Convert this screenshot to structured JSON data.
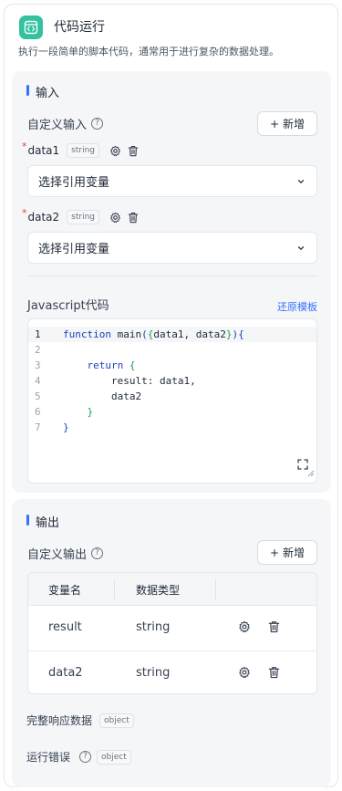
{
  "header": {
    "title": "代码运行",
    "description": "执行一段简单的脚本代码，通常用于进行复杂的数据处理。"
  },
  "input_section": {
    "title": "输入",
    "custom_input_label": "自定义输入",
    "add_label": "新增",
    "variables": [
      {
        "name": "data1",
        "type": "string",
        "placeholder": "选择引用变量"
      },
      {
        "name": "data2",
        "type": "string",
        "placeholder": "选择引用变量"
      }
    ],
    "code_label": "Javascript代码",
    "restore_label": "还原模板",
    "line_numbers": [
      "1",
      "2",
      "3",
      "4",
      "5",
      "6",
      "7"
    ]
  },
  "output_section": {
    "title": "输出",
    "custom_output_label": "自定义输出",
    "add_label": "新增",
    "columns": [
      "变量名",
      "数据类型"
    ],
    "rows": [
      {
        "name": "result",
        "type": "string"
      },
      {
        "name": "data2",
        "type": "string"
      }
    ],
    "full_response_label": "完整响应数据",
    "full_response_type": "object",
    "error_label": "运行错误",
    "error_type": "object"
  }
}
